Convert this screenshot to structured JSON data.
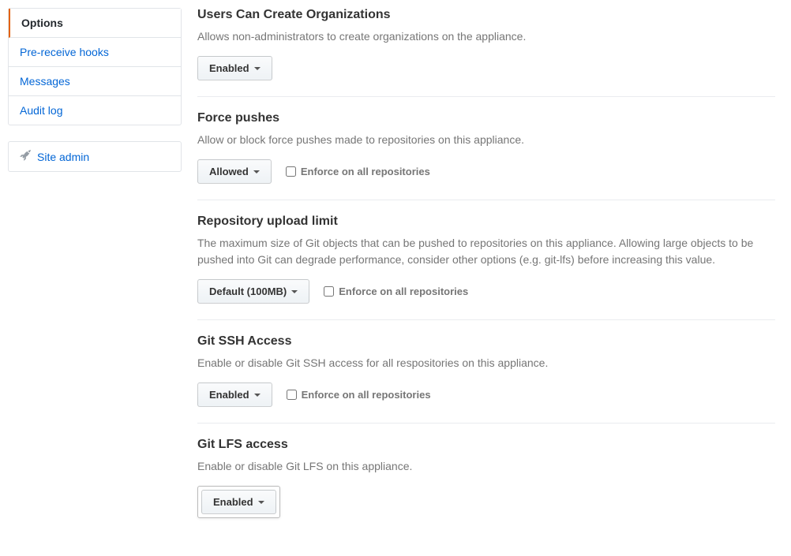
{
  "sidebar": {
    "items": [
      {
        "label": "Options",
        "active": true
      },
      {
        "label": "Pre-receive hooks",
        "active": false
      },
      {
        "label": "Messages",
        "active": false
      },
      {
        "label": "Audit log",
        "active": false
      }
    ],
    "site_admin_label": "Site admin"
  },
  "sections": {
    "orgs": {
      "title": "Users Can Create Organizations",
      "desc": "Allows non-administrators to create organizations on the appliance.",
      "button": "Enabled"
    },
    "force_pushes": {
      "title": "Force pushes",
      "desc": "Allow or block force pushes made to repositories on this appliance.",
      "button": "Allowed",
      "enforce": "Enforce on all repositories"
    },
    "repo_upload": {
      "title": "Repository upload limit",
      "desc": "The maximum size of Git objects that can be pushed to repositories on this appliance. Allowing large objects to be pushed into Git can degrade performance, consider other options (e.g. git-lfs) before increasing this value.",
      "button": "Default (100MB)",
      "enforce": "Enforce on all repositories"
    },
    "ssh_access": {
      "title": "Git SSH Access",
      "desc": "Enable or disable Git SSH access for all respositories on this appliance.",
      "button": "Enabled",
      "enforce": "Enforce on all repositories"
    },
    "lfs_access": {
      "title": "Git LFS access",
      "desc": "Enable or disable Git LFS on this appliance.",
      "button": "Enabled"
    }
  }
}
